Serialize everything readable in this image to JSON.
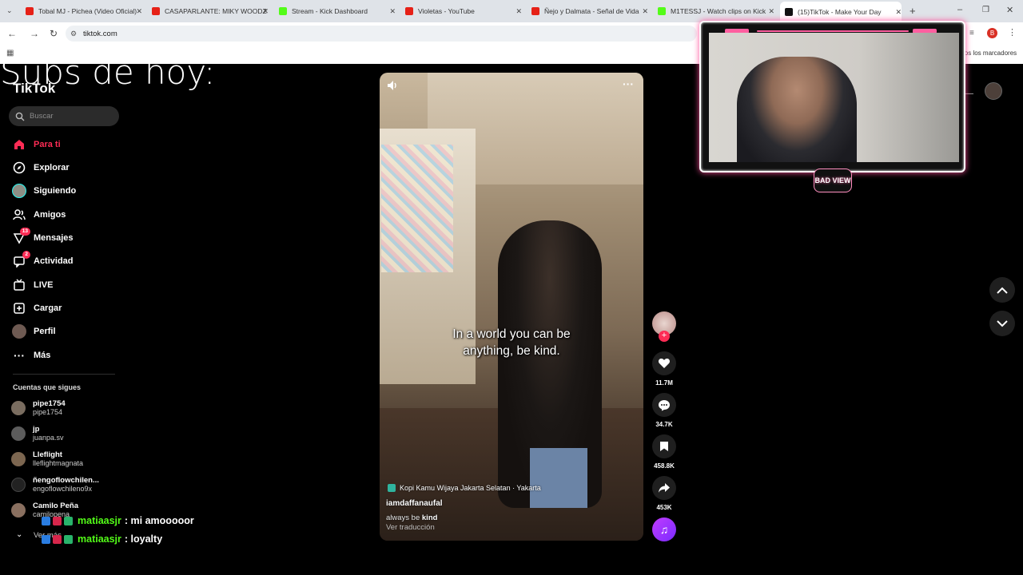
{
  "browser": {
    "tabs": [
      {
        "title": "Tobal MJ - Pichea (Video Oficial)",
        "color": "#e62117"
      },
      {
        "title": "CASAPARLANTE: MIKY WOODZ",
        "color": "#e62117"
      },
      {
        "title": "Stream - Kick Dashboard",
        "color": "#53fc18"
      },
      {
        "title": "Violetas - YouTube",
        "color": "#e62117"
      },
      {
        "title": "Ñejo y Dalmata - Señal de Vida",
        "color": "#e62117"
      },
      {
        "title": "M1TESSJ - Watch clips on Kick",
        "color": "#53fc18"
      },
      {
        "title": "(15)TikTok - Make Your Day",
        "color": "#111111"
      }
    ],
    "url": "tiktok.com",
    "bookmarks_text": "los los marcadores",
    "profile_initial": "B"
  },
  "overlay": {
    "title": "Subs de hoy:",
    "chat": [
      {
        "user": "matiaasjr",
        "message": ": mi amooooor"
      },
      {
        "user": "matiaasjr",
        "message": ": loyalty"
      }
    ],
    "cam_logo": "BAD VIEW"
  },
  "tiktok": {
    "logo": "TikTok",
    "search_placeholder": "Buscar",
    "nav": [
      {
        "label": "Para ti",
        "icon": "home-icon"
      },
      {
        "label": "Explorar",
        "icon": "compass-icon"
      },
      {
        "label": "Siguiendo",
        "icon": "following-avatar-icon"
      },
      {
        "label": "Amigos",
        "icon": "friends-icon"
      },
      {
        "label": "Mensajes",
        "icon": "messages-icon",
        "badge": "13"
      },
      {
        "label": "Actividad",
        "icon": "activity-icon",
        "badge": "2"
      },
      {
        "label": "LIVE",
        "icon": "live-icon"
      },
      {
        "label": "Cargar",
        "icon": "upload-icon"
      },
      {
        "label": "Perfil",
        "icon": "profile-avatar-icon"
      },
      {
        "label": "Más",
        "icon": "more-icon"
      }
    ],
    "following_title": "Cuentas que sigues",
    "following": [
      {
        "name": "pipe1754",
        "handle": "pipe1754"
      },
      {
        "name": "jp",
        "handle": "juanpa.sv"
      },
      {
        "name": "Lleflight",
        "handle": "lleflightmagnata"
      },
      {
        "name": "ñengoflowchilen...",
        "handle": "engoflowchileno9x"
      },
      {
        "name": "Camilo Peña",
        "handle": "camilopena"
      }
    ],
    "see_more": "Ver más",
    "video": {
      "caption": "In a world you can be anything, be kind.",
      "location": "Kopi Kamu Wijaya Jakarta Selatan · Yakarta",
      "username": "iamdaffanaufal",
      "description_prefix": "always be ",
      "description_bold": "kind",
      "translate": "Ver traducción"
    },
    "actions": {
      "likes": "11.7M",
      "comments": "34.7K",
      "saves": "458.8K",
      "shares": "453K"
    }
  }
}
